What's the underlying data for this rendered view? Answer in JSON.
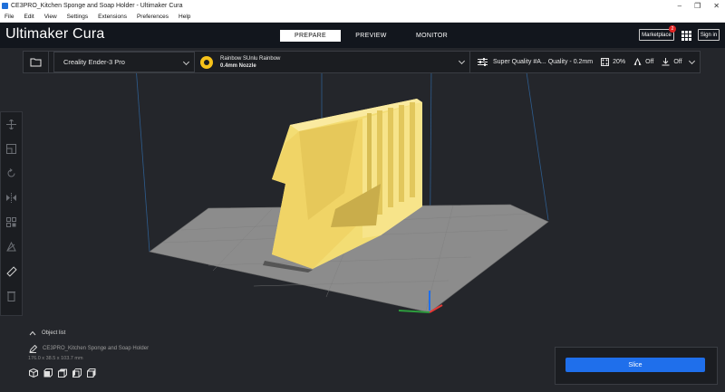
{
  "window": {
    "title": "CE3PRO_Kitchen Sponge and Soap Holder - Ultimaker Cura"
  },
  "menu": [
    "File",
    "Edit",
    "View",
    "Settings",
    "Extensions",
    "Preferences",
    "Help"
  ],
  "header": {
    "brand_light": "Ultimaker",
    "brand_bold": "Cura",
    "tabs": [
      {
        "label": "PREPARE",
        "active": true
      },
      {
        "label": "PREVIEW",
        "active": false
      },
      {
        "label": "MONITOR",
        "active": false
      }
    ],
    "marketplace_label": "Marketplace",
    "marketplace_badge": "2",
    "signin_label": "Sign in"
  },
  "printer_bar": {
    "printer": "Creality Ender-3 Pro",
    "extruder_index": "1",
    "material": "Rainbow SUnlu Rainbow",
    "nozzle": "0.4mm Nozzle",
    "profile": "Super Quality #A... Quality - 0.2mm",
    "infill": "20%",
    "support": "Off",
    "adhesion": "Off"
  },
  "tools": [
    "move-icon",
    "scale-icon",
    "rotate-icon",
    "mirror-icon",
    "per-model-settings-icon",
    "support-blocker-icon",
    "measure-icon",
    "trash-icon"
  ],
  "object_panel": {
    "header": "Object list",
    "object_name": "CE3PRO_Kitchen Sponge and Soap Holder",
    "dimensions": "176.0 x 38.5 x 103.7 mm"
  },
  "slice": {
    "button_label": "Slice"
  },
  "colors": {
    "accent": "#1f6feb",
    "model": "#f5e27a",
    "build_plate": "#8a8a8a",
    "background": "#24262b"
  }
}
